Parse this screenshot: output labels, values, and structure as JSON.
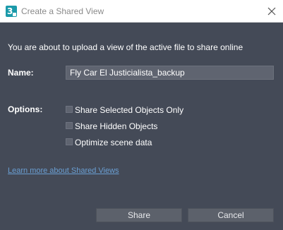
{
  "window": {
    "title": "Create a Shared View",
    "app_icon_letter": "3",
    "close_icon": "close-icon"
  },
  "intro_text": "You are about to upload a view of the active file to share online",
  "name": {
    "label": "Name:",
    "value": "Fly Car El Justicialista_backup"
  },
  "options": {
    "label": "Options:",
    "items": [
      {
        "label": "Share Selected Objects Only",
        "checked": false
      },
      {
        "label": "Share Hidden Objects",
        "checked": false
      },
      {
        "label": "Optimize scene data",
        "checked": false
      }
    ]
  },
  "learn_more_link": "Learn more about Shared Views",
  "buttons": {
    "share": "Share",
    "cancel": "Cancel"
  },
  "colors": {
    "background": "#444a57",
    "link": "#6a9fd3",
    "app_icon": "#1b9aaa"
  }
}
